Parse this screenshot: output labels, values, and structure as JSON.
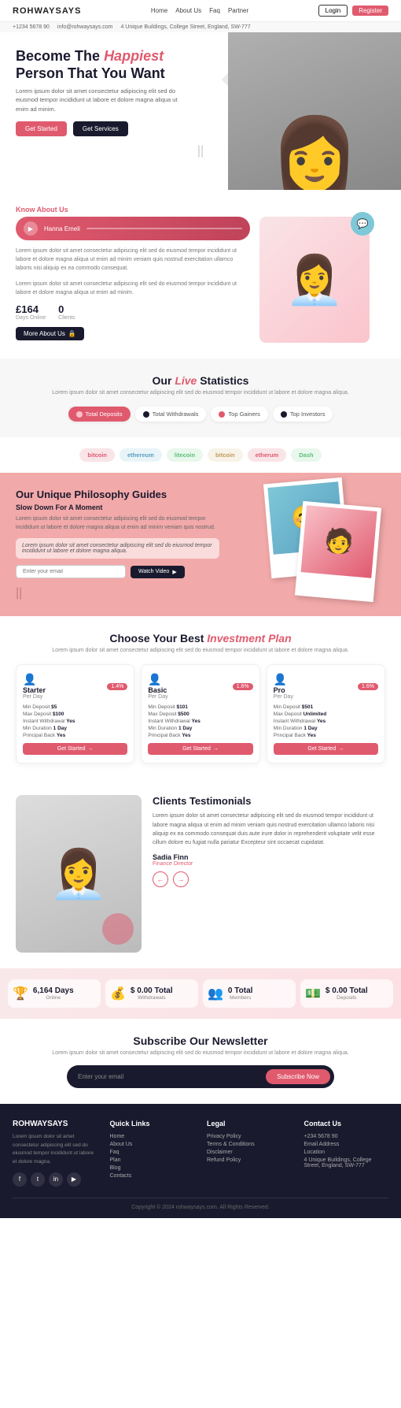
{
  "site": {
    "name": "ROHWAYSAYS",
    "tagline": "Become The Happiest Person That You Want"
  },
  "navbar": {
    "logo": "ROHWAYSAYS",
    "links": [
      "Home",
      "About Us",
      "Faq",
      "Partner"
    ],
    "contact_phone": "+1234 5678 90",
    "contact_email": "info@rohwaysays.com",
    "contact_location": "4 Unique Buildings, College Street, England, SW-777",
    "login_label": "Login",
    "register_label": "Register"
  },
  "hero": {
    "heading_line1": "Become The",
    "heading_italic": "Happiest",
    "heading_line2": "Person That You Want",
    "subtext": "Lorem ipsum dolor sit amet consectetur adipiscing elit sed do eiusmod tempor incididunt ut labore et dolore magna aliqua ut enim ad minim.",
    "btn_primary": "Get Started",
    "btn_secondary": "Get Services",
    "scroll_hint": "||"
  },
  "know_about": {
    "tag": "Know About Us",
    "audio_name": "Hanna Emeli",
    "body_text": "Lorem ipsum dolor sit amet consectetur adipiscing elit sed do eiusmod tempor incididunt ut labore et dolore magna aliqua ut enim ad minim veniam quis nostrud exercitation ullamco laboris nisi aliquip ex ea commodo consequat.",
    "body_text2": "Lorem ipsum dolor sit amet consectetur adipiscing elit sed do eiusmod tempor incididunt ut labore et dolore magna aliqua ut enim ad minim.",
    "stat1_num": "£164",
    "stat1_label": "Days Online",
    "stat2_num": "0",
    "stat2_label": "Clients",
    "btn_more": "More About Us"
  },
  "live_stats": {
    "title_plain": "Our",
    "title_italic": "Live",
    "title_rest": "Statistics",
    "subtitle": "Lorem ipsum dolor sit amet consectetur adipiscing elit sed do eiusmod tempor incididunt ut labore et dolore magna aliqua.",
    "tabs": [
      {
        "label": "Total Deposits",
        "active": true,
        "color": "#f9c0c8"
      },
      {
        "label": "Total Withdrawals",
        "active": false,
        "color": "#1a1a2e"
      },
      {
        "label": "Top Gainers",
        "active": false,
        "color": "#e05a6e"
      },
      {
        "label": "Top Investors",
        "active": false,
        "color": "#1a1a2e"
      }
    ]
  },
  "brands": [
    {
      "name": "bitcoin",
      "style": "default"
    },
    {
      "name": "ethereum",
      "style": "alt"
    },
    {
      "name": "litecoin",
      "style": "alt2"
    },
    {
      "name": "bitcoin",
      "style": "alt3"
    },
    {
      "name": "etherum",
      "style": "default"
    },
    {
      "name": "Dash",
      "style": "alt2"
    }
  ],
  "philosophy": {
    "title": "Our Unique Philosophy Guides",
    "subtitle": "Slow Down For A Moment",
    "body_text": "Lorem ipsum dolor sit amet consectetur adipiscing elit sed do eiusmod tempor incididunt ut labore et dolore magna aliqua ut enim ad minim veniam quis nostrud.",
    "quote": "Lorem ipsum dolor sit amet consectetur adipiscing elit sed do eiusmod tempor incididunt ut labore et dolore magna aliqua.",
    "input_placeholder": "Enter your email",
    "btn_label": "Watch Video",
    "scroll_hint": "||"
  },
  "investment": {
    "title_plain": "Choose Your Best",
    "title_italic": "Investment Plan",
    "subtitle": "Lorem ipsum dolor sit amet consectetur adipiscing elit sed do eiusmod tempor incididunt ut labore et dolore magna aliqua.",
    "plans": [
      {
        "name": "Starter",
        "fee_label": "Per Day",
        "badge": "1.4%",
        "min_deposit": "$5",
        "max_deposit": "$100",
        "instant_withdrawal": "Yes",
        "min_duration": "1 Day",
        "principal_back": "Yes",
        "btn": "Get Started"
      },
      {
        "name": "Basic",
        "fee_label": "Per Day",
        "badge": "1.6%",
        "min_deposit": "$101",
        "max_deposit": "$500",
        "instant_withdrawal": "Yes",
        "min_duration": "1 Day",
        "principal_back": "Yes",
        "btn": "Get Started"
      },
      {
        "name": "Pro",
        "fee_label": "Per Day",
        "badge": "1.6%",
        "min_deposit": "$501",
        "max_deposit": "Unlimited",
        "instant_withdrawal": "Yes",
        "min_duration": "1 Day",
        "principal_back": "Yes",
        "btn": "Get Started"
      }
    ]
  },
  "testimonials": {
    "title": "Clients Testimonials",
    "body_text": "Lorem ipsum dolor sit amet consectetur adipiscing elit sed do eiusmod tempor incididunt ut labore magna aliqua ut enim ad minim veniam quis nostrud exercitation ullamco laboris nisi aliquip ex ea commodo consequat duis aute irure dolor in reprehenderit voluptate velit esse cillum dolore eu fugiat nulla pariatur Excepteur sint occaecat cupidatat.",
    "client_name": "Sadia Finn",
    "client_role": "Finance Director",
    "prev_label": "←",
    "next_label": "→"
  },
  "counter_stats": [
    {
      "icon": "🏆",
      "num": "6,164 Days",
      "label": "Online"
    },
    {
      "icon": "💰",
      "num": "$ 0.00 Total",
      "label": "Withdrawals"
    },
    {
      "icon": "👥",
      "num": "0 Total",
      "label": "Members"
    },
    {
      "icon": "💵",
      "num": "$ 0.00 Total",
      "label": "Deposits"
    }
  ],
  "newsletter": {
    "title": "Subscribe Our Newsletter",
    "subtitle": "Lorem ipsum dolor sit amet consectetur adipiscing elit sed do eiusmod tempor incididunt ut labore et dolore magna aliqua.",
    "input_placeholder": "Enter your email",
    "btn_label": "Subscribe Now"
  },
  "footer": {
    "logo": "ROHWAYSAYS",
    "description": "Lorem ipsum dolor sit amet consectetur adipiscing elit sed do eiusmod tempor incididunt ut labore et dolore magna.",
    "social": [
      "f",
      "t",
      "in",
      "yt"
    ],
    "quick_links": {
      "heading": "Quick Links",
      "links": [
        "Home",
        "About Us",
        "Faq",
        "Plan",
        "Blog",
        "Contacts"
      ]
    },
    "legal": {
      "heading": "Legal",
      "links": [
        "Privacy Policy",
        "Terms & Conditions",
        "Disclaimer",
        "Refund Policy"
      ]
    },
    "contact": {
      "heading": "Contact Us",
      "phone": "+234 5678 90",
      "email": "Email Address",
      "label": "Location",
      "address": "4 Unique Buildings, College Street, England, SW-777"
    },
    "copyright": "Copyright © 2024 rohwaysays.com. All Rights Reserved."
  }
}
